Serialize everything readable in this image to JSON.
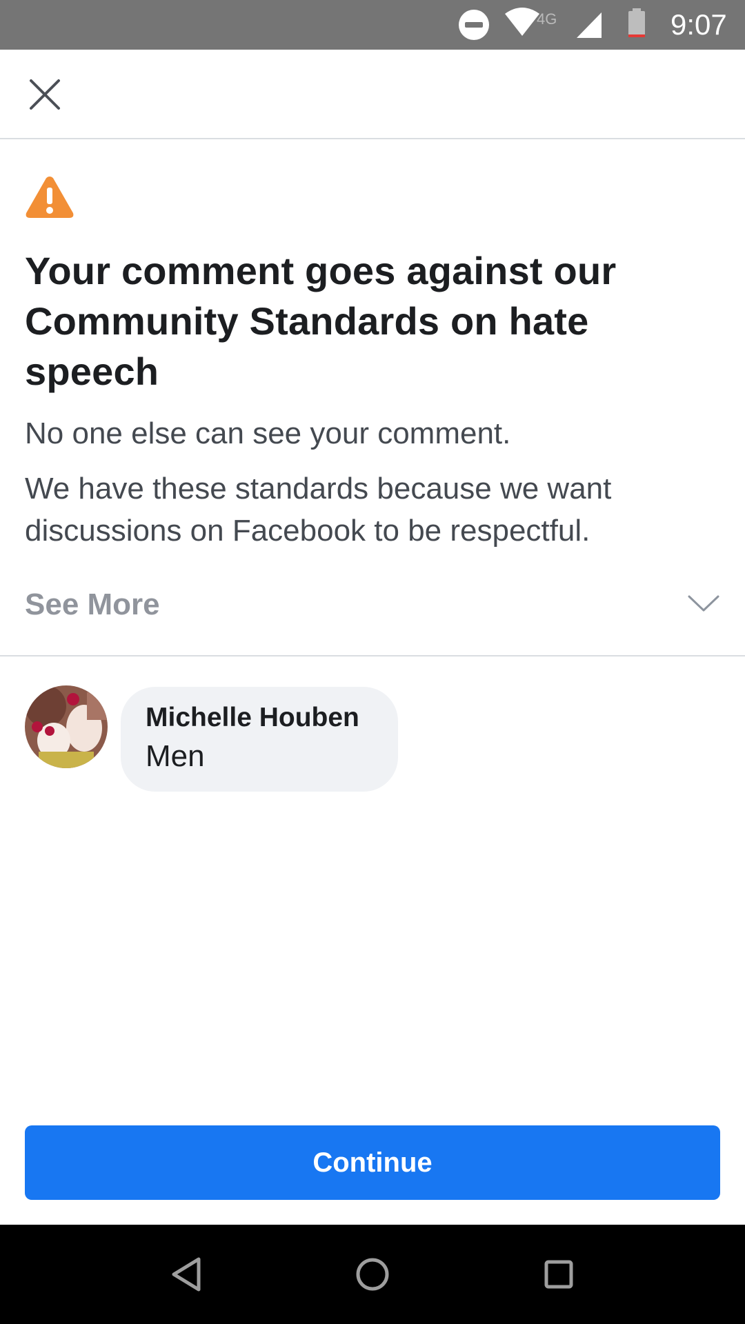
{
  "status_bar": {
    "time": "9:07",
    "network": "4G",
    "icons": [
      "do-not-disturb-icon",
      "wifi-icon",
      "cellular-signal-icon",
      "battery-icon"
    ],
    "background": "#757575"
  },
  "header": {
    "close_icon": "close-icon"
  },
  "notice": {
    "icon": "warning-icon",
    "icon_color": "#f28f36",
    "title": "Your comment goes against our Community Standards on hate speech",
    "line1": "No one else can see your comment.",
    "line2": "We have these standards because we want discussions on Facebook to be respectful.",
    "see_more": "See More"
  },
  "comment": {
    "author": "Michelle Houben",
    "text": "Men"
  },
  "footer": {
    "continue_label": "Continue",
    "accent": "#1877f2"
  },
  "nav_bar": {
    "icons": [
      "back-icon",
      "home-icon",
      "recents-icon"
    ]
  }
}
